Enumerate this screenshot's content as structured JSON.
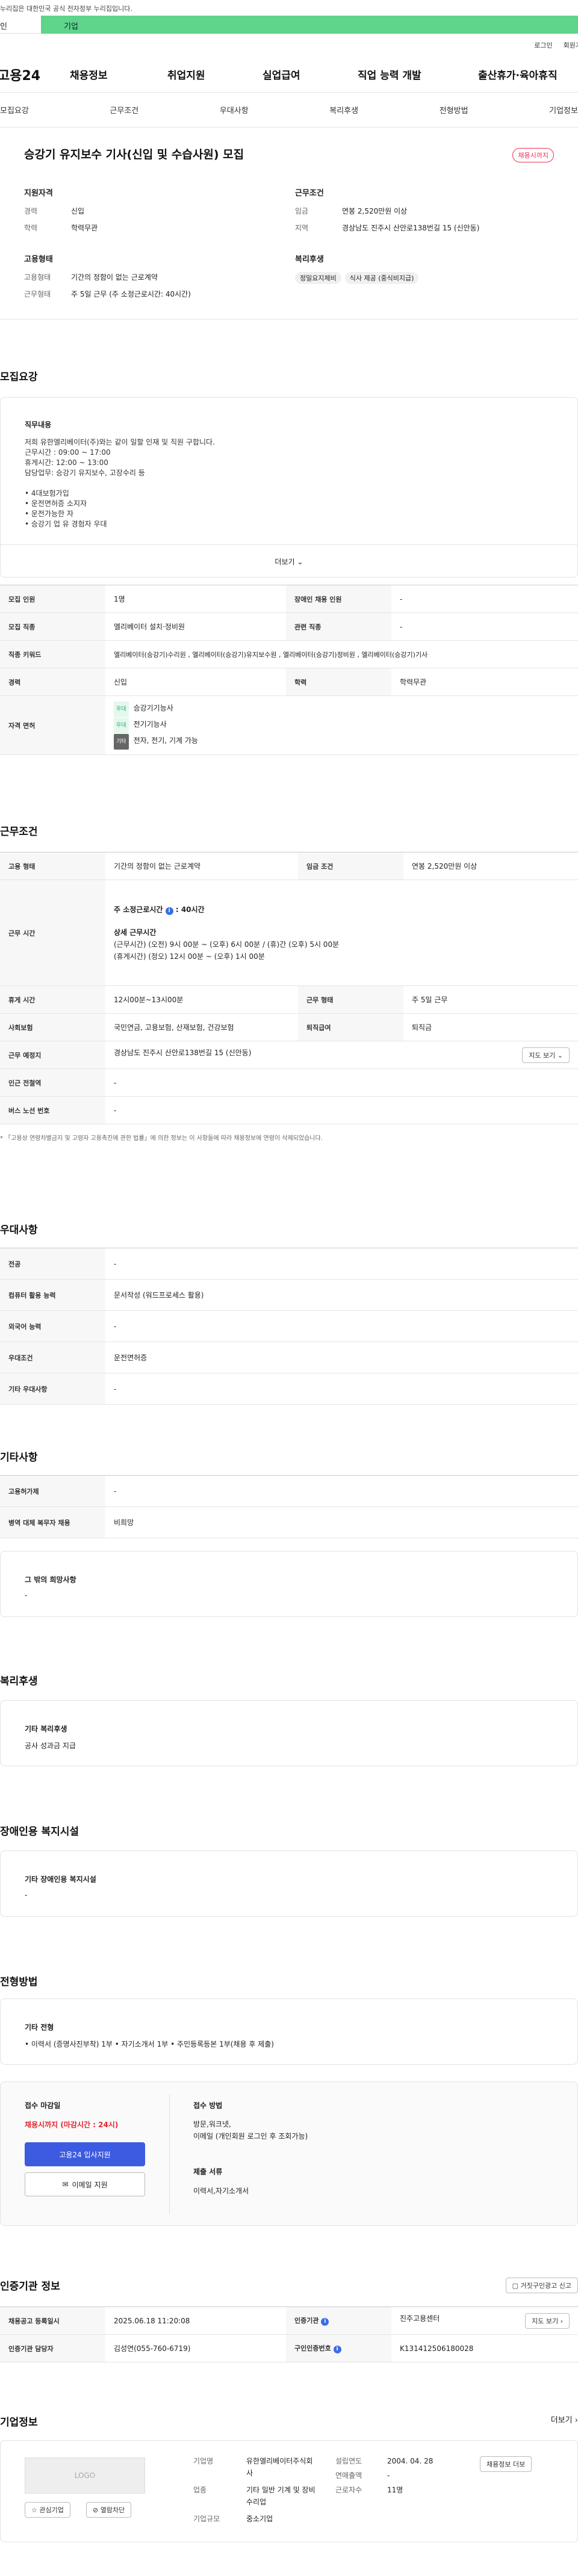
{
  "gov_banner": "누리집은 대한민국 공식 전자정부 누리집입니다.",
  "user_tabs": [
    "인",
    "기업"
  ],
  "util_links": [
    "로그인",
    "회원가"
  ],
  "gnb": {
    "logo": "고용24",
    "menu": [
      "채용정보",
      "취업지원",
      "실업급여",
      "직업 능력 개발",
      "출산휴가·육아휴직"
    ]
  },
  "anchor_tabs": [
    "모집요강",
    "근무조건",
    "우대사항",
    "복리후생",
    "전형방법",
    "기업정보"
  ],
  "summary": {
    "title": "승강기 유지보수 기사(신입 및 수습사원) 모집",
    "badge": "채용시까지",
    "req_title": "지원자격",
    "career_label": "경력",
    "career_value": "신입",
    "edu_label": "학력",
    "edu_value": "학력무관",
    "emp_title": "고용형태",
    "emp_label": "고용형태",
    "emp_value": "기간의 정함이 없는 근로계약",
    "hours_label": "근무형태",
    "hours_value": "주 5일 근무 (주 소정근로시간: 40시간)",
    "cond_title": "근무조건",
    "wage_label": "임금",
    "wage_value": "연봉 2,520만원 이상",
    "loc_label": "지역",
    "loc_value": "경상남도 진주시 산안로138번길 15 (신안동)",
    "welfare_title": "복리후생",
    "welfare_chips": [
      "정밀요지체비",
      "식사 제공 (중식비지급)"
    ]
  },
  "recruit": {
    "title": "모집요강",
    "duty_title": "직무내용",
    "duty_lines": [
      "저희 유한엘리베이터(주)와는 같이 일할 인재 및 직원 구합니다.",
      "근무시간 : 09:00 ~ 17:00",
      "휴게시간: 12:00 ~ 13:00",
      "담당업무: 승강기 유지보수, 고장수리 등",
      "",
      "• 4대보험가입",
      "• 운전면허증 소지자",
      "• 운전가능한 자",
      "• 승강기 업 유 경험자 우대"
    ],
    "more": "더보기",
    "rows": {
      "headcount_label": "모집 인원",
      "headcount_value": "1명",
      "disabled_label": "장애인 채용 인원",
      "disabled_value": "-",
      "job_label": "모집 직종",
      "job_value": "엘리베이터 설치·정비원",
      "related_label": "관련 직종",
      "related_value": "-",
      "keyword_label": "직종 키워드",
      "keyword_value": "엘리베이터(승강기)수리원 , 엘리베이터(승강기)유지보수원 , 엘리베이터(승강기)정비원 , 엘리베이터(승강기)기사",
      "career_label": "경력",
      "career_value": "신입",
      "edu_label": "학력",
      "edu_value": "학력무관",
      "license_label": "자격 면허",
      "licenses": [
        {
          "tag": "우대",
          "name": "승강기기능사"
        },
        {
          "tag": "우대",
          "name": "전기기능사"
        },
        {
          "tag": "기타",
          "name": "전자, 전기, 기계 가능"
        }
      ]
    }
  },
  "work": {
    "title": "근무조건",
    "type_label": "고용 형태",
    "type_value": "기간의 정함이 없는 근로계약",
    "wage_label": "임금 조건",
    "wage_value": "연봉 2,520만원 이상",
    "time_label": "근무 시간",
    "weekly_title": "주 소정근로시간",
    "weekly_value": "40시간",
    "detail_title": "상세 근무시간",
    "detail_lines": [
      "(근무시간) (오전) 9시 00분 ~ (오후) 6시 00분 / (휴)간 (오후) 5시 00분",
      "(휴게시간) (정오) 12시 00분 ~ (오후) 1시 00분"
    ],
    "break_label": "휴게 시간",
    "break_value": "12시00분~13시00분",
    "shift_label": "근무 형태",
    "shift_value": "주 5일 근무",
    "insurance_label": "사회보험",
    "insurance_value": "국민연금, 고용보험, 산재보험, 건강보험",
    "retire_label": "퇴직급여",
    "retire_value": "퇴직금",
    "place_label": "근무 예정지",
    "place_value": "경상남도 진주시 산안로138번길 15 (신안동)",
    "map_btn": "지도 보기",
    "subway_label": "인근 전철역",
    "subway_value": "-",
    "bus_label": "버스 노선 번호",
    "bus_value": "-",
    "note": "* 「고용상 연령차별금지 및 고령자 고용촉진에 관한 법률」에 의한 정보는 이 사항들에 따라 채용정보에 연령이 삭제되었습니다."
  },
  "prefer": {
    "title": "우대사항",
    "major_label": "전공",
    "major_value": "-",
    "pc_label": "컴퓨터 활용 능력",
    "pc_value": "문서작성 (워드프로세스 활용)",
    "lang_label": "외국어 능력",
    "lang_value": "-",
    "cond_label": "우대조건",
    "cond_value": "운전면허증",
    "etc_label": "기타 우대사항",
    "etc_value": "-"
  },
  "other": {
    "title": "기타사항",
    "visa_label": "고용허가제",
    "visa_value": "-",
    "military_label": "병역 대체 복무자 채용",
    "military_value": "비희망",
    "wish_title": "그 밖의 희망사항",
    "wish_value": "-"
  },
  "welfare": {
    "title": "복리후생",
    "box_title": "기타 복리후생",
    "box_value": "공사 성과금 지급"
  },
  "disability": {
    "title": "장애인용 복지시설",
    "box_title": "기타 장애인용 복지시설",
    "box_value": "-"
  },
  "selection": {
    "title": "전형방법",
    "box_title": "기타 전형",
    "box_value": "• 이력서 (증명사진부착) 1부 • 자기소개서 1부 • 주민등록등본 1부(채용 후 제출)",
    "deadline_title": "접수 마감일",
    "deadline_value": "채용시까지 (마감시간 : 24시)",
    "apply_btn": "고용24 입사지원",
    "email_btn": "이메일 지원",
    "method_title": "접수 방법",
    "method_lines": [
      "방문,워크넷,",
      "이메일 (개인회원 로그인 후 조회가능)"
    ],
    "docs_title": "제출 서류",
    "docs_value": "이력서,자기소개서"
  },
  "cert": {
    "title": "인증기관 정보",
    "report_btn": "거짓구인광고 신고",
    "reg_label": "채용공고 등록일시",
    "reg_value": "2025.06.18 11:20:08",
    "org_label": "인증기관",
    "org_value": "진주고용센터",
    "map_btn": "지도 보기",
    "staff_label": "인증기관 담당자",
    "staff_value": "김성연(055-760-6719)",
    "id_label": "구인인증번호",
    "id_value": "K131412506180028"
  },
  "company": {
    "title": "기업정보",
    "more": "더보기",
    "logo": "LOGO",
    "fav_btn": "관심기업",
    "block_btn": "열람차단",
    "name_label": "기업명",
    "name_value": "유한엘리베이터주식회사",
    "industry_label": "업종",
    "industry_value": "기타 일반 기계 및 장비 수리업",
    "size_label": "기업규모",
    "size_value": "중소기업",
    "est_label": "설립연도",
    "est_value": "2004. 04. 28",
    "sales_label": "연매출액",
    "sales_value": "-",
    "emp_label": "근로자수",
    "emp_value": "11명",
    "info_btn": "채용정보 더보"
  }
}
